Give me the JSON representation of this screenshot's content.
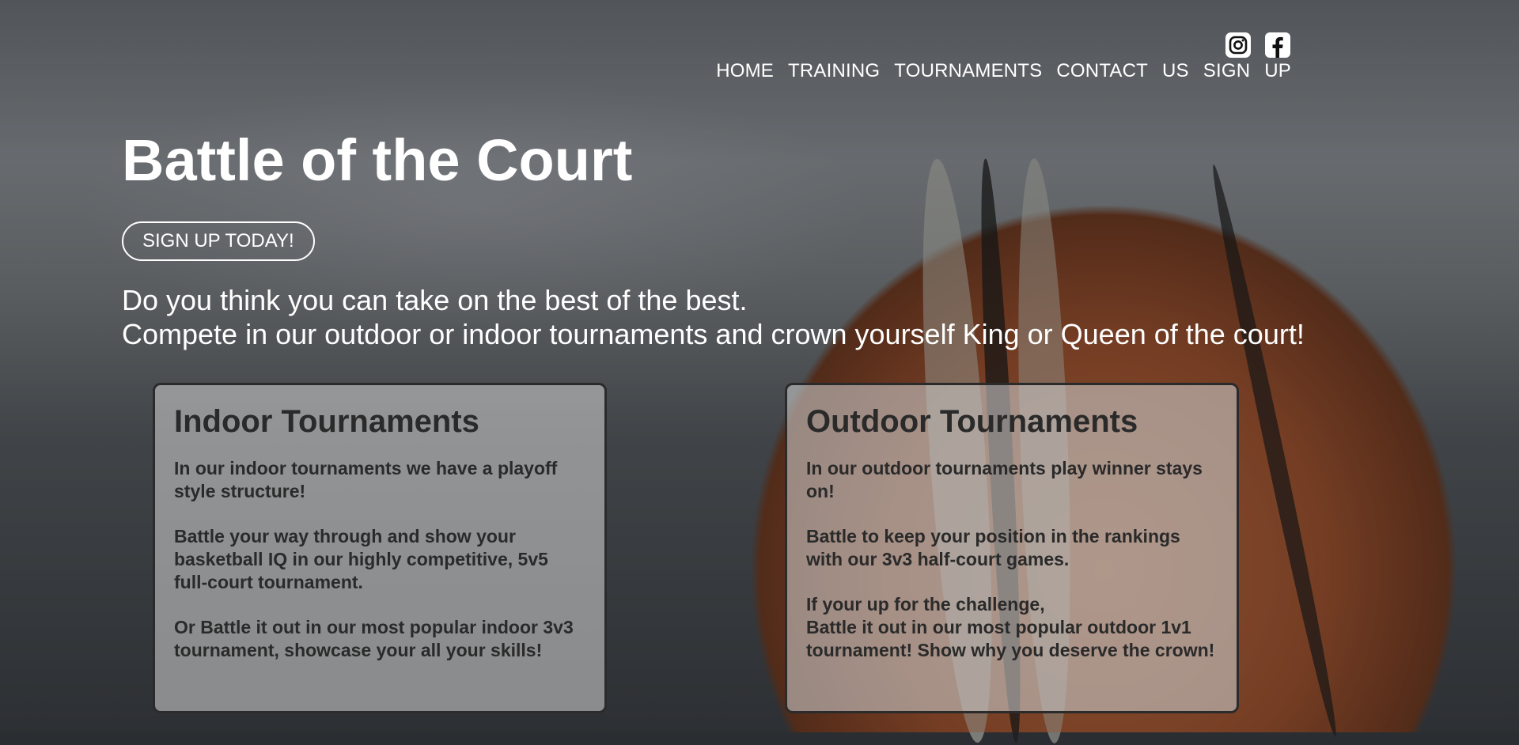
{
  "colors": {
    "text_light": "#ffffff",
    "card_text": "#2a2a2a",
    "card_border": "#2b2b2b"
  },
  "social": {
    "instagram": {
      "icon": "instagram-icon"
    },
    "facebook": {
      "icon": "facebook-icon"
    }
  },
  "nav": {
    "items": [
      {
        "label": "HOME"
      },
      {
        "label": "TRAINING"
      },
      {
        "label": "TOURNAMENTS"
      },
      {
        "label": "CONTACT"
      },
      {
        "label": "US"
      },
      {
        "label": "SIGN"
      },
      {
        "label": "UP"
      }
    ]
  },
  "hero": {
    "title": "Battle of the Court",
    "cta_label": "SIGN UP TODAY!",
    "intro_line1": "Do you think you can take on the best of the best.",
    "intro_line2": "Compete in our outdoor or indoor tournaments and crown yourself King or Queen of the court!"
  },
  "cards": {
    "indoor": {
      "title": "Indoor Tournaments",
      "paragraphs": [
        "In our indoor tournaments we have a playoff style structure!",
        "Battle your way through and show your basketball IQ in our highly competitive, 5v5 full-court tournament.",
        "Or Battle it out in our most popular indoor 3v3 tournament, showcase your all your skills!"
      ]
    },
    "outdoor": {
      "title": "Outdoor Tournaments",
      "paragraphs": [
        "In our outdoor tournaments play winner stays on!",
        "Battle to keep your position in the rankings with our 3v3 half-court games.",
        "If your up for the challenge,",
        "Battle it out in our most popular outdoor 1v1 tournament! Show why you deserve the crown!"
      ]
    }
  }
}
